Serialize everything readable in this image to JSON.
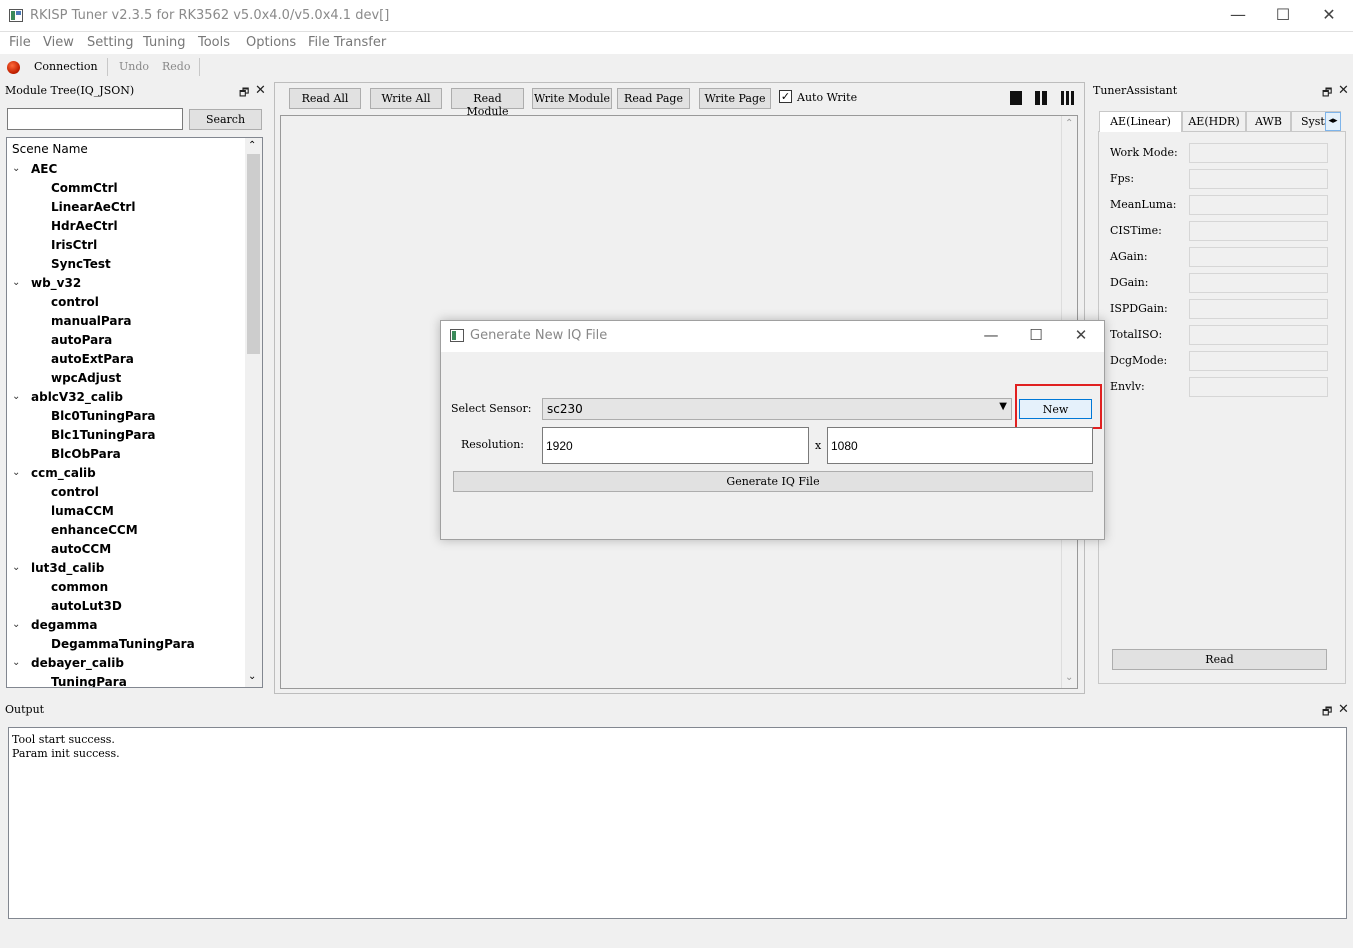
{
  "window": {
    "title": "RKISP Tuner v2.3.5 for RK3562 v5.0x4.0/v5.0x4.1 dev[]",
    "minimize": "—",
    "maximize": "☐",
    "close": "✕"
  },
  "menu": [
    "File",
    "View",
    "Setting",
    "Tuning",
    "Tools",
    "Options",
    "File Transfer"
  ],
  "toolbar": {
    "connection": "Connection",
    "undo": "Undo",
    "redo": "Redo"
  },
  "left_panel": {
    "title": "Module Tree(IQ_JSON)",
    "search_value": "",
    "search_button": "Search",
    "tree_header": "Scene Name",
    "tree": [
      {
        "name": "AEC",
        "children": [
          "CommCtrl",
          "LinearAeCtrl",
          "HdrAeCtrl",
          "IrisCtrl",
          "SyncTest"
        ]
      },
      {
        "name": "wb_v32",
        "children": [
          "control",
          "manualPara",
          "autoPara",
          "autoExtPara",
          "wpcAdjust"
        ]
      },
      {
        "name": "ablcV32_calib",
        "children": [
          "Blc0TuningPara",
          "Blc1TuningPara",
          "BlcObPara"
        ]
      },
      {
        "name": "ccm_calib",
        "children": [
          "control",
          "lumaCCM",
          "enhanceCCM",
          "autoCCM"
        ]
      },
      {
        "name": "lut3d_calib",
        "children": [
          "common",
          "autoLut3D"
        ]
      },
      {
        "name": "degamma",
        "children": [
          "DegammaTuningPara"
        ]
      },
      {
        "name": "debayer_calib",
        "children": [
          "TuningPara"
        ]
      }
    ]
  },
  "center_panel": {
    "buttons": [
      "Read All",
      "Write All",
      "Read Module",
      "Write Module",
      "Read Page",
      "Write Page"
    ],
    "auto_write_label": "Auto Write",
    "auto_write_checked": true
  },
  "tuner_assistant": {
    "title": "TunerAssistant",
    "tabs": [
      "AE(Linear)",
      "AE(HDR)",
      "AWB",
      "System"
    ],
    "active_tab": "AE(Linear)",
    "fields": [
      "Work Mode:",
      "Fps:",
      "MeanLuma:",
      "CISTime:",
      "AGain:",
      "DGain:",
      "ISPDGain:",
      "TotalISO:",
      "DcgMode:",
      "Envlv:"
    ],
    "read_button": "Read"
  },
  "output": {
    "title": "Output",
    "lines": [
      "Tool start success.",
      "Param init success."
    ]
  },
  "dialog": {
    "title": "Generate New IQ File",
    "select_sensor_label": "Select Sensor:",
    "sensor_value": "sc230",
    "new_button": "New",
    "resolution_label": "Resolution:",
    "width_value": "1920",
    "x_separator": "x",
    "height_value": "1080",
    "generate_button": "Generate IQ File"
  },
  "colors": {
    "highlight": "#e02020",
    "connection_indicator": "#c22000",
    "new_button_border": "#0078d7"
  }
}
